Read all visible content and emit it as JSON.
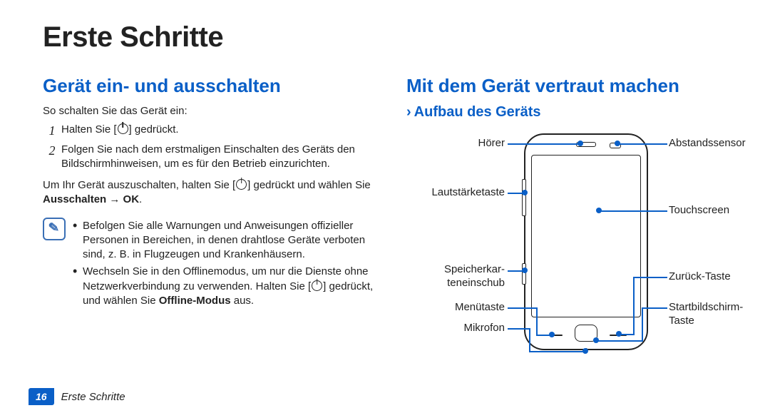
{
  "title": "Erste Schritte",
  "left": {
    "heading": "Gerät ein- und ausschalten",
    "intro": "So schalten Sie das Gerät ein:",
    "step1": "Halten Sie [",
    "step1b": "] gedrückt.",
    "step2": "Folgen Sie nach dem erstmaligen Einschalten des Geräts den Bildschirmhinweisen, um es für den Betrieb einzurichten.",
    "off_a": "Um Ihr Gerät auszuschalten, halten Sie [",
    "off_b": "] gedrückt und wählen Sie ",
    "off_bold": "Ausschalten → OK",
    "note1": "Befolgen Sie alle Warnungen und Anweisungen offizieller Personen in Bereichen, in denen drahtlose Geräte verboten sind, z. B. in Flugzeugen und Krankenhäusern.",
    "note2a": "Wechseln Sie in den Offlinemodus, um nur die Dienste ohne Netzwerkverbindung zu verwenden. Halten Sie [",
    "note2b": "] gedrückt, und wählen Sie ",
    "note2bold": "Offline-Modus",
    "note2c": " aus."
  },
  "right": {
    "heading": "Mit dem Gerät vertraut machen",
    "sub": "Aufbau des Geräts",
    "labels": {
      "hoerer": "Hörer",
      "lautstaerke": "Lautstärketaste",
      "speicher1": "Speicherkar-",
      "speicher2": "teneinschub",
      "menue": "Menütaste",
      "mikro": "Mikrofon",
      "abstand": "Abstandssensor",
      "touch": "Touchscreen",
      "zurueck": "Zurück-Taste",
      "home1": "Startbildschirm-",
      "home2": "Taste"
    }
  },
  "footer": {
    "page": "16",
    "section": "Erste Schritte"
  }
}
